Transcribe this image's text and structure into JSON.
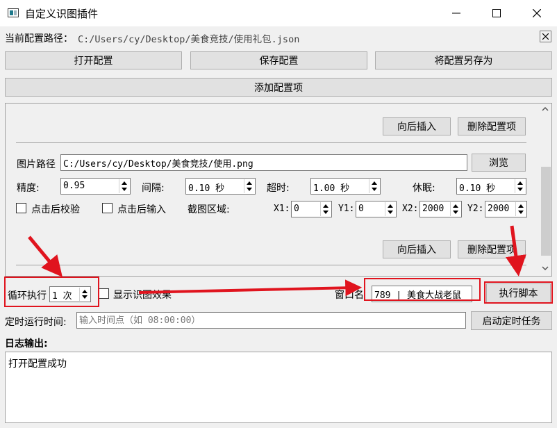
{
  "window": {
    "title": "自定义识图插件",
    "minimize_icon": "minimize-icon",
    "maximize_icon": "maximize-icon",
    "close_icon": "close-icon"
  },
  "config": {
    "path_label": "当前配置路径：",
    "path_value": "C:/Users/cy/Desktop/美食竞技/使用礼包.json",
    "open_label": "打开配置",
    "save_label": "保存配置",
    "save_as_label": "将配置另存为",
    "add_label": "添加配置项"
  },
  "item1": {
    "insert_after_label": "向后插入",
    "delete_label": "删除配置项"
  },
  "item2": {
    "image_path_label": "图片路径",
    "image_path_value": "C:/Users/cy/Desktop/美食竞技/使用.png",
    "browse_label": "浏览",
    "precision_label": "精度:",
    "precision_value": "0.95",
    "interval_label": "间隔:",
    "interval_value": "0.10 秒",
    "timeout_label": "超时:",
    "timeout_value": "1.00 秒",
    "sleep_label": "休眠:",
    "sleep_value": "0.10 秒",
    "verify_after_click_label": "点击后校验",
    "input_after_click_label": "点击后输入",
    "capture_region_label": "截图区域:",
    "x1_label": "X1:",
    "x1_value": "0",
    "y1_label": "Y1:",
    "y1_value": "0",
    "x2_label": "X2:",
    "x2_value": "2000",
    "y2_label": "Y2:",
    "y2_value": "2000",
    "insert_after_label": "向后插入",
    "delete_label": "删除配置项"
  },
  "run": {
    "loop_label": "循环执行",
    "loop_value": "1 次",
    "show_effect_label": "显示识图效果",
    "window_name_label": "窗口名",
    "window_name_value": "789 | 美食大战老鼠",
    "execute_label": "执行脚本",
    "schedule_label": "定时运行时间:",
    "schedule_placeholder": "输入时间点（如 08:00:00）",
    "schedule_start_label": "启动定时任务"
  },
  "log": {
    "title": "日志输出:",
    "content": "打开配置成功"
  },
  "colors": {
    "annotation_red": "#e0141e"
  }
}
